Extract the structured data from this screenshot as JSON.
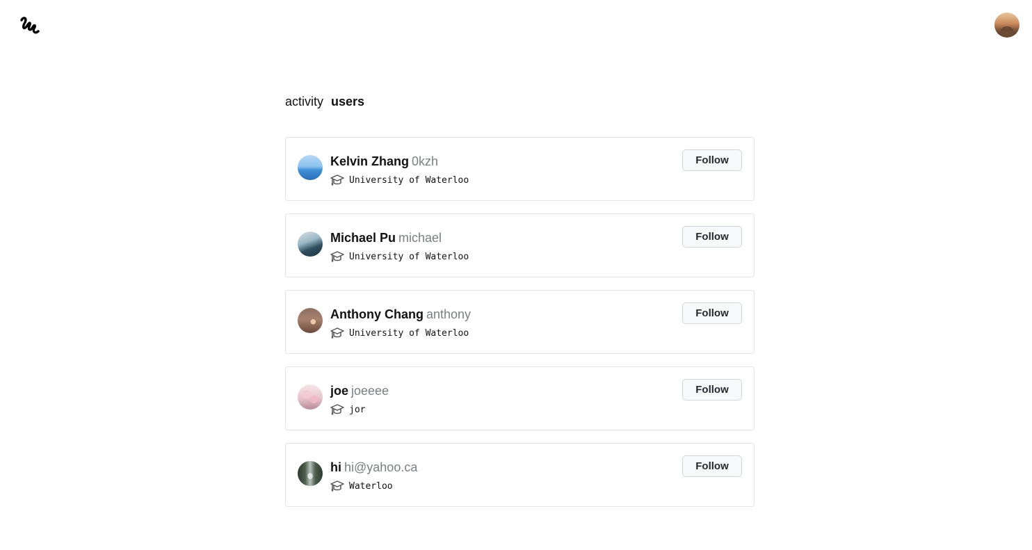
{
  "header": {
    "logo_icon": "squiggle-logo-icon",
    "profile_avatar": "user-avatar"
  },
  "tabs": [
    {
      "label": "activity",
      "active": false
    },
    {
      "label": "users",
      "active": true
    }
  ],
  "users": [
    {
      "name": "Kelvin Zhang",
      "handle": "0kzh",
      "school_icon": "graduation-cap-icon",
      "school": "University of Waterloo",
      "follow_label": "Follow"
    },
    {
      "name": "Michael Pu",
      "handle": "michael",
      "school_icon": "graduation-cap-icon",
      "school": "University of Waterloo",
      "follow_label": "Follow"
    },
    {
      "name": "Anthony Chang",
      "handle": "anthony",
      "school_icon": "graduation-cap-icon",
      "school": "University of Waterloo",
      "follow_label": "Follow"
    },
    {
      "name": "joe",
      "handle": "joeeee",
      "school_icon": "graduation-cap-icon",
      "school": "jor",
      "follow_label": "Follow"
    },
    {
      "name": "hi",
      "handle": "hi@yahoo.ca",
      "school_icon": "graduation-cap-icon",
      "school": "Waterloo",
      "follow_label": "Follow"
    }
  ],
  "colors": {
    "handle": "#7a7f85",
    "card_border": "#e3e3e3",
    "button_bg": "#f6f8fa",
    "button_border": "#d2d5d9"
  }
}
